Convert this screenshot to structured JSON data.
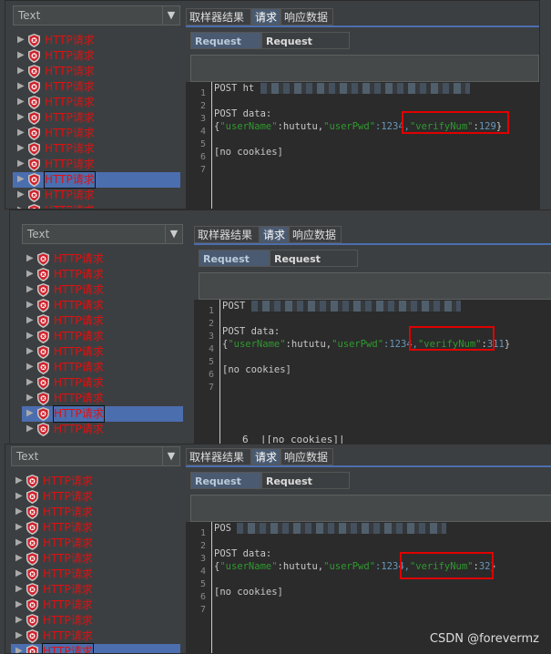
{
  "panels": [
    {
      "combo_value": "Text",
      "tree_items": [
        "HTTP请求",
        "HTTP请求",
        "HTTP请求",
        "HTTP请求",
        "HTTP请求",
        "HTTP请求",
        "HTTP请求",
        "HTTP请求",
        "HTTP请求",
        "HTTP请求",
        "HTTP请求",
        "HTTP请求"
      ],
      "selected_index": 9,
      "tabs": [
        "取样器结果",
        "请求",
        "响应数据"
      ],
      "active_tab": 1,
      "subtabs": [
        "Request Body",
        "Request Headers"
      ],
      "active_subtab": 0,
      "line_numbers": [
        "1",
        "2",
        "3",
        "4",
        "5",
        "6",
        "7"
      ],
      "line1": "POST ht",
      "line3": "POST data:",
      "line4": {
        "open": "{",
        "k1": "\"userName\"",
        "v1": ":hututu,",
        "k2": "\"userPwd\"",
        "v2": ":1234,",
        "k3": "\"verifyNum\"",
        "c3": ":",
        "v3": "129",
        "close": "}"
      },
      "line6": "[no cookies]"
    },
    {
      "combo_value": "Text",
      "tree_items": [
        "HTTP请求",
        "HTTP请求",
        "HTTP请求",
        "HTTP请求",
        "HTTP请求",
        "HTTP请求",
        "HTTP请求",
        "HTTP请求",
        "HTTP请求",
        "HTTP请求",
        "HTTP请求",
        "HTTP请求"
      ],
      "selected_index": 10,
      "tabs": [
        "取样器结果",
        "请求",
        "响应数据"
      ],
      "active_tab": 1,
      "subtabs": [
        "Request Body",
        "Request Headers"
      ],
      "active_subtab": 0,
      "line_numbers": [
        "1",
        "2",
        "3",
        "4",
        "5",
        "6",
        "7"
      ],
      "line1": "POST",
      "line3": "POST data:",
      "line4": {
        "open": "{",
        "k1": "\"userName\"",
        "v1": ":hututu,",
        "k2": "\"userPwd\"",
        "v2": ":1234,",
        "k3": "\"verifyNum\"",
        "c3": ":",
        "v3": "311",
        "close": "}"
      },
      "line6": "[no cookies]",
      "overflow_line": {
        "number": "6",
        "text": "[no cookies]"
      }
    },
    {
      "combo_value": "Text",
      "tree_items": [
        "HTTP请求",
        "HTTP请求",
        "HTTP请求",
        "HTTP请求",
        "HTTP请求",
        "HTTP请求",
        "HTTP请求",
        "HTTP请求",
        "HTTP请求",
        "HTTP请求",
        "HTTP请求",
        "HTTP请求"
      ],
      "selected_index": 11,
      "tabs": [
        "取样器结果",
        "请求",
        "响应数据"
      ],
      "active_tab": 1,
      "subtabs": [
        "Request Body",
        "Request Headers"
      ],
      "active_subtab": 0,
      "line_numbers": [
        "1",
        "2",
        "3",
        "4",
        "5",
        "6",
        "7"
      ],
      "line1": "POS",
      "line3": "POST data:",
      "line4": {
        "open": "{",
        "k1": "\"userName\"",
        "v1": ":hututu,",
        "k2": "\"userPwd\"",
        "v2": ":1234,",
        "k3": "\"verifyNum\"",
        "c3": ":",
        "v3": "32",
        "close": "}"
      },
      "line6": "[no cookies]"
    }
  ],
  "watermark": "CSDN @forevermz",
  "colors": {
    "error_label": "#e01010",
    "selection": "#4b6eaf",
    "highlight_box": "#e00000",
    "json_key": "#2f9a2f",
    "json_number": "#6897bb"
  }
}
